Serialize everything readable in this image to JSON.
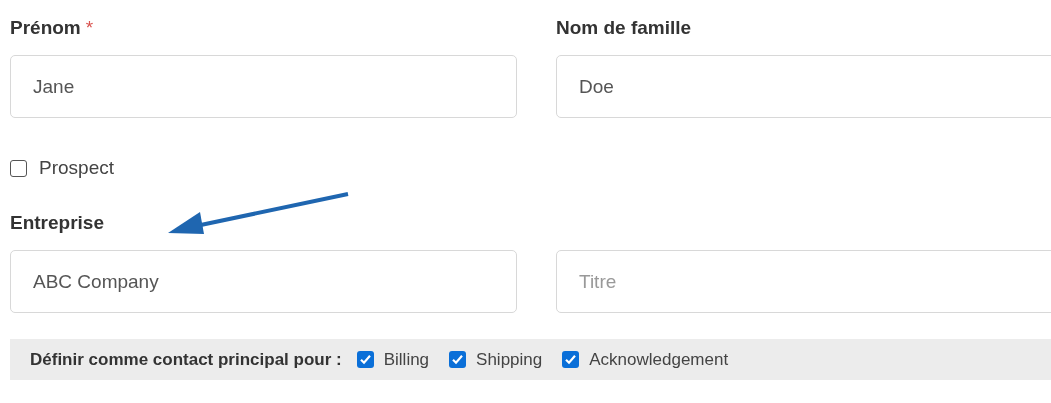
{
  "name_row": [
    {
      "label": "Prénom",
      "required_mark": "*",
      "value": "Jane"
    },
    {
      "label": "Nom de famille",
      "value": "Doe"
    }
  ],
  "prospect": {
    "label": "Prospect",
    "checked": false
  },
  "company_row": [
    {
      "label": "Entreprise",
      "value": "ABC Company"
    },
    {
      "placeholder": "Titre"
    }
  ],
  "primary_contact": {
    "label": "Définir comme contact principal pour :",
    "options": [
      {
        "label": "Billing",
        "checked": true
      },
      {
        "label": "Shipping",
        "checked": true
      },
      {
        "label": "Acknowledgement",
        "checked": true
      }
    ]
  }
}
